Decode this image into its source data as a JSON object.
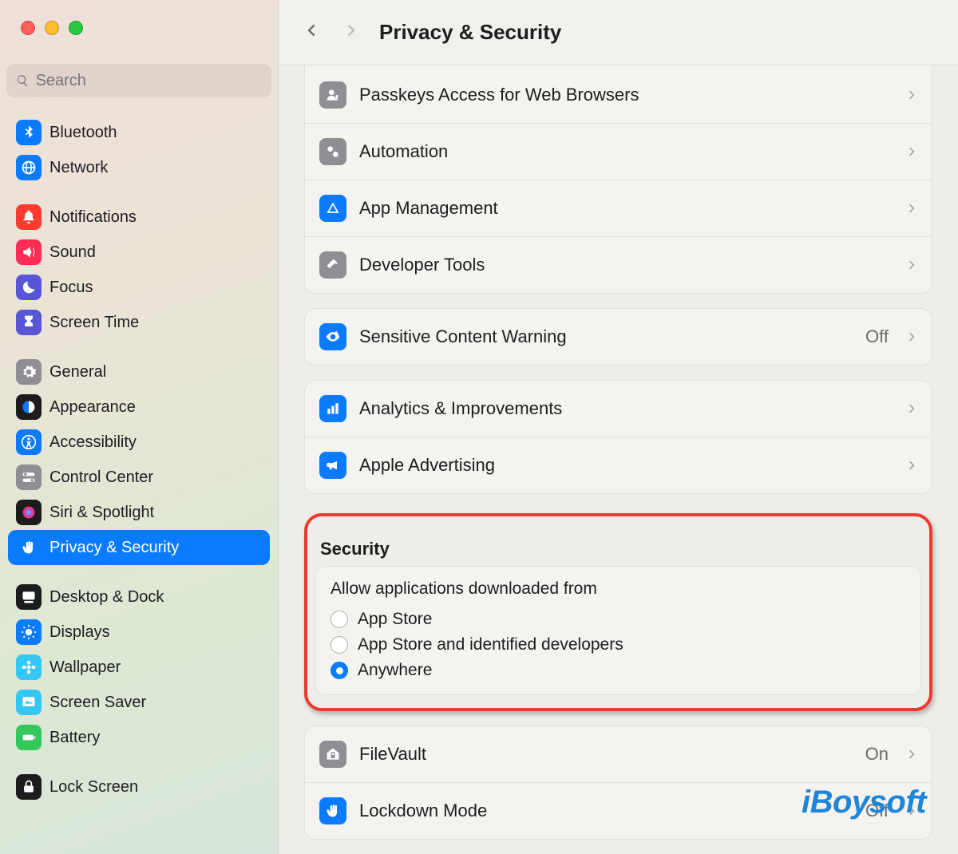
{
  "header": {
    "title": "Privacy & Security"
  },
  "search": {
    "placeholder": "Search"
  },
  "sidebar": {
    "groups": [
      {
        "items": [
          {
            "label": "Bluetooth",
            "icon": "bluetooth",
            "color": "#0A7AFF"
          },
          {
            "label": "Network",
            "icon": "globe",
            "color": "#0A7AFF"
          }
        ]
      },
      {
        "items": [
          {
            "label": "Notifications",
            "icon": "bell",
            "color": "#FF3B30"
          },
          {
            "label": "Sound",
            "icon": "speaker",
            "color": "#FF2D55"
          },
          {
            "label": "Focus",
            "icon": "moon",
            "color": "#5856D6"
          },
          {
            "label": "Screen Time",
            "icon": "hourglass",
            "color": "#5856D6"
          }
        ]
      },
      {
        "items": [
          {
            "label": "General",
            "icon": "gear",
            "color": "#8E8E93"
          },
          {
            "label": "Appearance",
            "icon": "appearance",
            "color": "#1C1C1E"
          },
          {
            "label": "Accessibility",
            "icon": "accessibility",
            "color": "#0A7AFF"
          },
          {
            "label": "Control Center",
            "icon": "switches",
            "color": "#8E8E93"
          },
          {
            "label": "Siri & Spotlight",
            "icon": "siri",
            "color": "#1C1C1E"
          },
          {
            "label": "Privacy & Security",
            "icon": "hand",
            "color": "#0A7AFF",
            "selected": true
          }
        ]
      },
      {
        "items": [
          {
            "label": "Desktop & Dock",
            "icon": "dock",
            "color": "#1C1C1E"
          },
          {
            "label": "Displays",
            "icon": "sun",
            "color": "#0A7AFF"
          },
          {
            "label": "Wallpaper",
            "icon": "flower",
            "color": "#34C7F5"
          },
          {
            "label": "Screen Saver",
            "icon": "screensaver",
            "color": "#34C7F5"
          },
          {
            "label": "Battery",
            "icon": "battery",
            "color": "#34C759"
          }
        ]
      },
      {
        "items": [
          {
            "label": "Lock Screen",
            "icon": "lock",
            "color": "#1C1C1E"
          }
        ]
      }
    ]
  },
  "content": {
    "group1": [
      {
        "label": "Passkeys Access for Web Browsers",
        "icon": "person-key",
        "color": "#8E8E93"
      },
      {
        "label": "Automation",
        "icon": "gears",
        "color": "#8E8E93"
      },
      {
        "label": "App Management",
        "icon": "appstore",
        "color": "#0A7AFF"
      },
      {
        "label": "Developer Tools",
        "icon": "hammer",
        "color": "#8E8E93"
      }
    ],
    "group2": [
      {
        "label": "Sensitive Content Warning",
        "icon": "eye-warning",
        "color": "#0A7AFF",
        "value": "Off"
      }
    ],
    "group3": [
      {
        "label": "Analytics & Improvements",
        "icon": "bars",
        "color": "#0A7AFF"
      },
      {
        "label": "Apple Advertising",
        "icon": "megaphone",
        "color": "#0A7AFF"
      }
    ],
    "security": {
      "title": "Security",
      "allow": {
        "heading": "Allow applications downloaded from",
        "options": [
          {
            "label": "App Store",
            "selected": false
          },
          {
            "label": "App Store and identified developers",
            "selected": false
          },
          {
            "label": "Anywhere",
            "selected": true
          }
        ]
      }
    },
    "group4": [
      {
        "label": "FileVault",
        "icon": "house-lock",
        "color": "#8E8E93",
        "value": "On"
      },
      {
        "label": "Lockdown Mode",
        "icon": "hand",
        "color": "#0A7AFF",
        "value": "Off"
      }
    ]
  },
  "watermark": "iBoysoft"
}
